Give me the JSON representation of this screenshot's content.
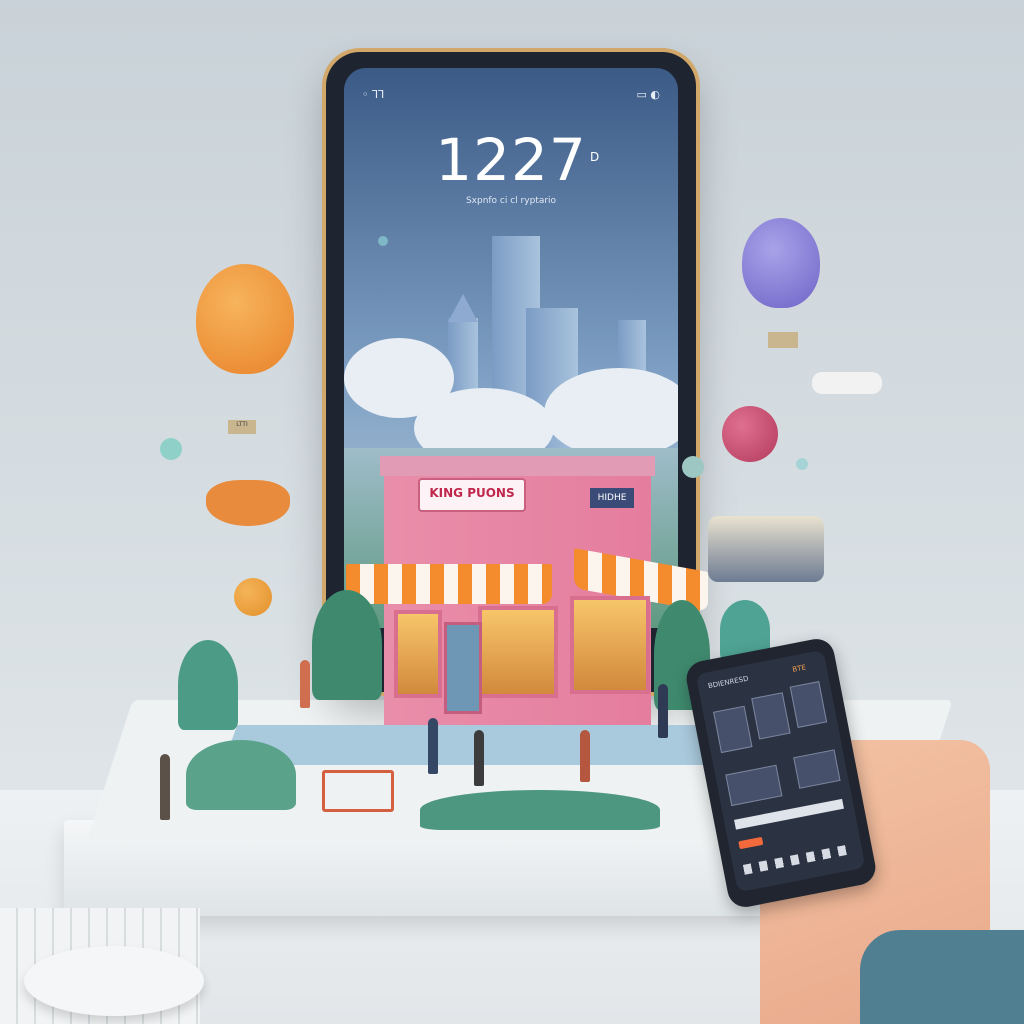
{
  "phone": {
    "status_left": "◦  ⅂⅂",
    "status_right": "▭  ◐",
    "clock": "1227",
    "clock_suffix": "D",
    "clock_sub": "Sxpnfo ci cl ryptario"
  },
  "store": {
    "sign": "KING PUONS",
    "side_sign": "HIDHE"
  },
  "balloon_basket_label": "LTTI",
  "small_phone": {
    "title": "BDIENRESD",
    "badge": "BTE"
  },
  "colors": {
    "frame": "#d2a86a",
    "store": "#e98eaa",
    "awning": "#f48b2c",
    "sky": "#3b5a86"
  }
}
